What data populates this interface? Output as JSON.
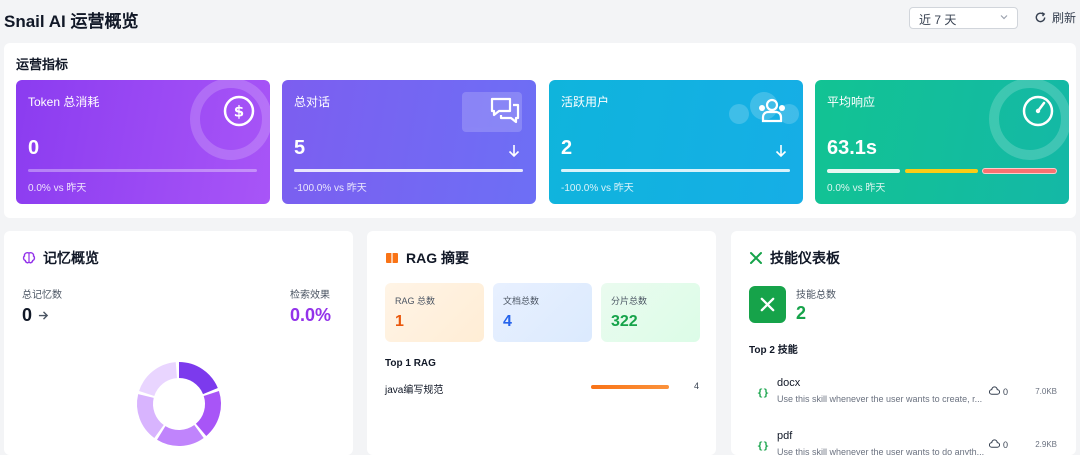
{
  "header": {
    "title": "Snail AI 运营概览",
    "range_value": "近 7 天",
    "refresh_label": "刷新"
  },
  "metrics": {
    "section_title": "运营指标",
    "cards": [
      {
        "label": "Token 总消耗",
        "value": "0",
        "delta": "0.0% vs 昨天",
        "icon": "dollar-icon"
      },
      {
        "label": "总对话",
        "value": "5",
        "delta": "-100.0% vs 昨天",
        "icon": "chat-icon"
      },
      {
        "label": "活跃用户",
        "value": "2",
        "delta": "-100.0% vs 昨天",
        "icon": "users-icon"
      },
      {
        "label": "平均响应",
        "value": "63.1s",
        "delta": "0.0% vs 昨天",
        "icon": "speedometer-icon"
      }
    ]
  },
  "memory": {
    "title": "记忆概览",
    "total_label": "总记忆数",
    "total_value": "0",
    "search_label": "检索效果",
    "search_value": "0.0%"
  },
  "rag": {
    "title": "RAG 摘要",
    "stats": [
      {
        "label": "RAG 总数",
        "value": "1"
      },
      {
        "label": "文档总数",
        "value": "4"
      },
      {
        "label": "分片总数",
        "value": "322"
      }
    ],
    "top_title": "Top 1 RAG",
    "top_items": [
      {
        "name": "java编写规范",
        "count": "4",
        "fraction": 1.0
      }
    ]
  },
  "skills": {
    "title": "技能仪表板",
    "total_label": "技能总数",
    "total_value": "2",
    "top_title": "Top 2 技能",
    "items": [
      {
        "name": "docx",
        "desc": "Use this skill whenever the user wants to create, r...",
        "downloads": "0",
        "size": "7.0KB"
      },
      {
        "name": "pdf",
        "desc": "Use this skill whenever the user wants to do anyth...",
        "downloads": "0",
        "size": "2.9KB"
      }
    ]
  },
  "colors": {
    "card1": "#8b3cf0",
    "card2": "#7c5ef0",
    "card3": "#0fb4dc",
    "card4": "#12c393",
    "rag_accent": "#f97316",
    "skill_accent": "#16a34a",
    "memory_accent": "#9333ea"
  }
}
